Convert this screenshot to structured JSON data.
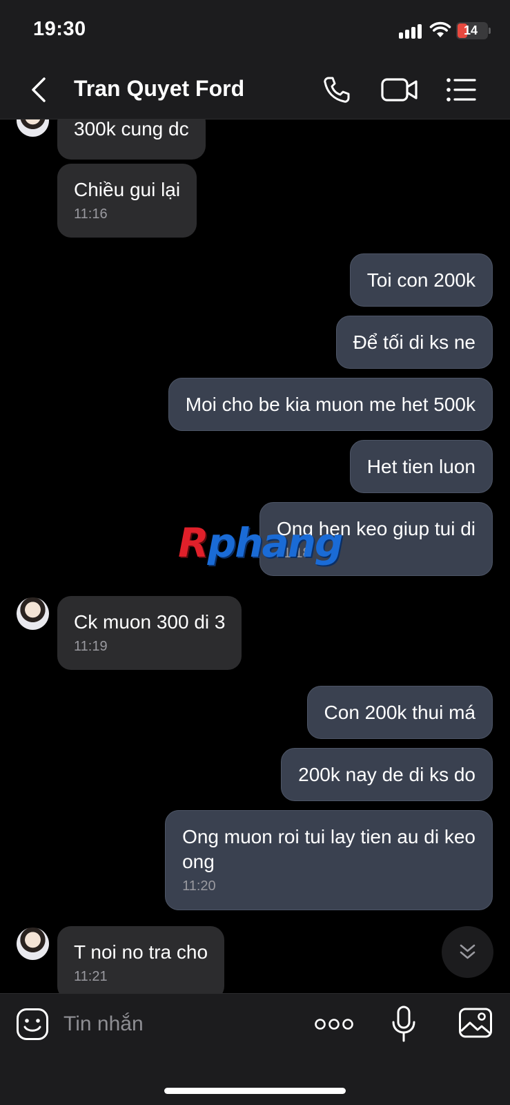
{
  "status_bar": {
    "time": "19:30",
    "battery_level": "14",
    "icons": [
      "cellular-signal-icon",
      "wifi-icon",
      "battery-icon"
    ]
  },
  "header": {
    "contact_name": "Tran Quyet Ford",
    "icons": [
      "back-chevron-icon",
      "phone-call-icon",
      "video-call-icon",
      "menu-list-icon"
    ]
  },
  "messages": [
    {
      "direction": "incoming",
      "text": "300k cung dc",
      "time": ""
    },
    {
      "direction": "incoming",
      "text": "Chiều gui lại",
      "time": "11:16"
    },
    {
      "direction": "outgoing",
      "text": "Toi con 200k",
      "time": ""
    },
    {
      "direction": "outgoing",
      "text": "Để tối di ks ne",
      "time": ""
    },
    {
      "direction": "outgoing",
      "text": "Moi cho be kia muon me het 500k",
      "time": ""
    },
    {
      "direction": "outgoing",
      "text": "Het tien luon",
      "time": ""
    },
    {
      "direction": "outgoing",
      "text": "Ong hen keo giup tui di",
      "time": "11:18"
    },
    {
      "direction": "incoming",
      "text": "Ck muon 300 di 3",
      "time": "11:19"
    },
    {
      "direction": "outgoing",
      "text": "Con 200k thui má",
      "time": ""
    },
    {
      "direction": "outgoing",
      "text": "200k nay de di ks do",
      "time": ""
    },
    {
      "direction": "outgoing",
      "text_line1": "Ong muon roi tui lay tien au di keo",
      "text_line2": "ong",
      "time": "11:20"
    },
    {
      "direction": "incoming",
      "text": "T noi no tra cho",
      "time": "11:21"
    }
  ],
  "watermark": {
    "r": "R",
    "rest": "phang"
  },
  "composer": {
    "placeholder": "Tin nhắn",
    "icons": [
      "sticker-icon",
      "more-options-icon",
      "microphone-icon",
      "image-gallery-icon"
    ]
  },
  "colors": {
    "background": "#000000",
    "bar": "#1c1c1e",
    "incoming_bubble": "#2c2c2e",
    "outgoing_bubble": "#3a4150",
    "timestamp": "#9a9aa0"
  }
}
